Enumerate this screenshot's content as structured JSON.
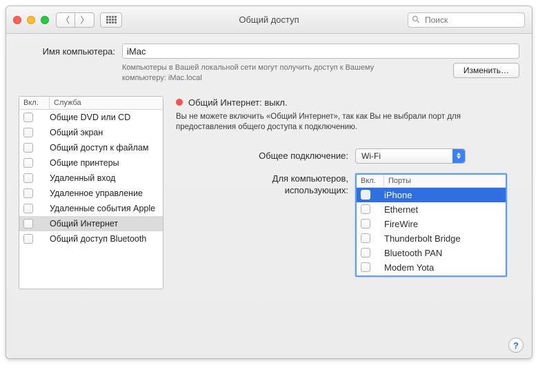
{
  "window": {
    "title": "Общий доступ"
  },
  "search": {
    "placeholder": "Поиск"
  },
  "computer": {
    "label": "Имя компьютера:",
    "value": "iMac",
    "hint": "Компьютеры в Вашей локальной сети могут получить доступ к Вашему компьютеру: iMac.local",
    "edit_btn": "Изменить…"
  },
  "services": {
    "col_on": "Вкл.",
    "col_service": "Служба",
    "items": [
      {
        "label": "Общие DVD или CD"
      },
      {
        "label": "Общий экран"
      },
      {
        "label": "Общий доступ к файлам"
      },
      {
        "label": "Общие принтеры"
      },
      {
        "label": "Удаленный вход"
      },
      {
        "label": "Удаленное управление"
      },
      {
        "label": "Удаленные события Apple"
      },
      {
        "label": "Общий Интернет"
      },
      {
        "label": "Общий доступ Bluetooth"
      }
    ]
  },
  "right": {
    "status_title": "Общий Интернет: выкл.",
    "status_msg": "Вы не можете включить «Общий Интернет», так как Вы не выбрали порт для предоставления общего доступа к подключению.",
    "share_from_label": "Общее подключение:",
    "share_from_value": "Wi-Fi",
    "ports_label_1": "Для компьютеров,",
    "ports_label_2": "использующих:",
    "ports_col_on": "Вкл.",
    "ports_col_name": "Порты",
    "ports": [
      {
        "label": "iPhone"
      },
      {
        "label": "Ethernet"
      },
      {
        "label": "FireWire"
      },
      {
        "label": "Thunderbolt Bridge"
      },
      {
        "label": "Bluetooth PAN"
      },
      {
        "label": "Modem Yota"
      }
    ]
  },
  "help": "?"
}
